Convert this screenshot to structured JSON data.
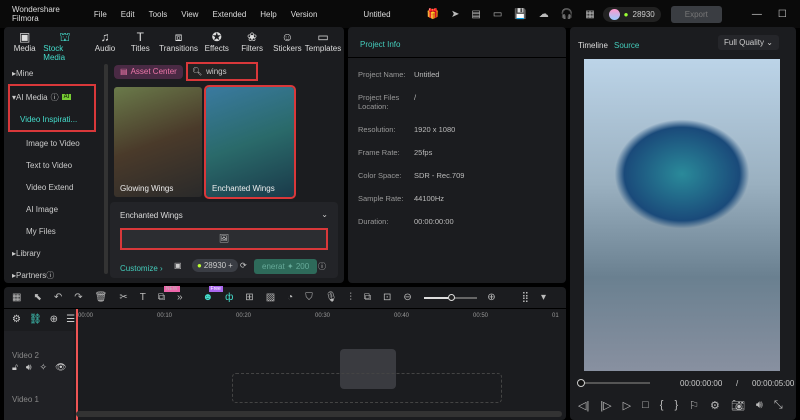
{
  "app": {
    "name": "Wondershare Filmora",
    "project_title": "Untitled",
    "credits": "28930",
    "export_label": "Export"
  },
  "menu": [
    "File",
    "Edit",
    "Tools",
    "View",
    "Extended",
    "Help",
    "Version"
  ],
  "toolbar": [
    {
      "label": "Media",
      "icon": "media-icon"
    },
    {
      "label": "Stock Media",
      "icon": "stock-media-icon"
    },
    {
      "label": "Audio",
      "icon": "audio-icon"
    },
    {
      "label": "Titles",
      "icon": "titles-icon"
    },
    {
      "label": "Transitions",
      "icon": "transitions-icon"
    },
    {
      "label": "Effects",
      "icon": "effects-icon"
    },
    {
      "label": "Filters",
      "icon": "filters-icon"
    },
    {
      "label": "Stickers",
      "icon": "stickers-icon"
    },
    {
      "label": "Templates",
      "icon": "templates-icon"
    }
  ],
  "sidebar": {
    "items": [
      "Mine",
      "AI Media",
      "Video Inspirati...",
      "Image to Video",
      "Text to Video",
      "Video Extend",
      "AI Image",
      "My Files",
      "Library",
      "Partners"
    ],
    "ai_badge": "AI"
  },
  "search": {
    "asset_center": "Asset Center",
    "query": "wings"
  },
  "results": [
    {
      "title": "Glowing Wings"
    },
    {
      "title": "Enchanted Wings"
    }
  ],
  "detail": {
    "title": "Enchanted Wings",
    "customize": "Customize",
    "credits": "28930",
    "generate": "enerat",
    "generate_cost": "200"
  },
  "project_info": {
    "title": "Project Info",
    "rows": [
      [
        "Project Name:",
        "Untitled"
      ],
      [
        "Project Files Location:",
        "/"
      ],
      [
        "Resolution:",
        "1920 x 1080"
      ],
      [
        "Frame Rate:",
        "25fps"
      ],
      [
        "Color Space:",
        "SDR - Rec.709"
      ],
      [
        "Sample Rate:",
        "44100Hz"
      ],
      [
        "Duration:",
        "00:00:00:00"
      ]
    ]
  },
  "preview": {
    "tab_timeline": "Timeline",
    "tab_source": "Source",
    "quality": "Full Quality",
    "current": "00:00:00:00",
    "total": "00:00:05:00",
    "progress": 0
  },
  "timeline": {
    "ticks": [
      "00:00",
      "00:10",
      "00:20",
      "00:30",
      "00:40",
      "00:50",
      "01"
    ],
    "tracks": [
      "Video 2",
      "Video 1"
    ],
    "new_badge": "NEW",
    "free_badge": "Free",
    "zoom": 0.45
  }
}
